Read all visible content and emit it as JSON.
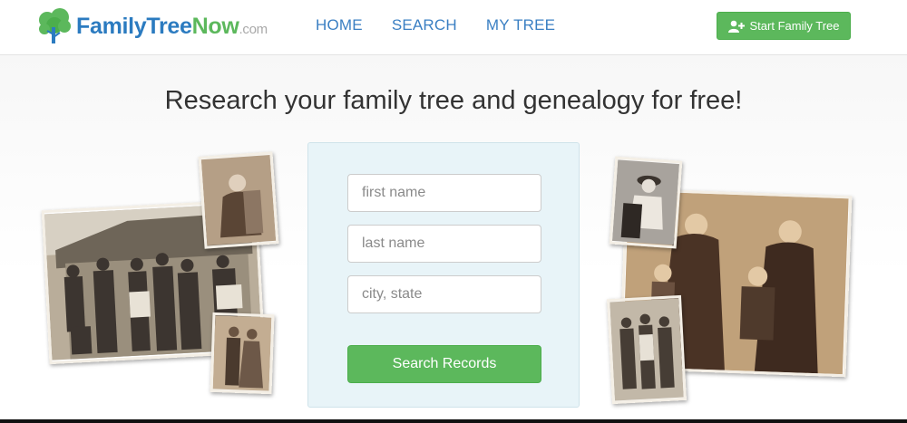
{
  "nav": {
    "brand_part1": "FamilyTree",
    "brand_part2": "Now",
    "brand_part3": ".com",
    "links": [
      "HOME",
      "SEARCH",
      "MY TREE"
    ],
    "start_button": "Start Family Tree"
  },
  "hero": {
    "headline": "Research your family tree and genealogy for free!"
  },
  "search": {
    "first_name_placeholder": "first name",
    "last_name_placeholder": "last name",
    "location_placeholder": "city, state",
    "button_label": "Search Records"
  },
  "colors": {
    "brand_blue": "#2b7bc0",
    "brand_green": "#5cb85c",
    "panel_bg": "#e8f4f8"
  },
  "icons": [
    "tree-logo-icon",
    "add-user-icon"
  ]
}
